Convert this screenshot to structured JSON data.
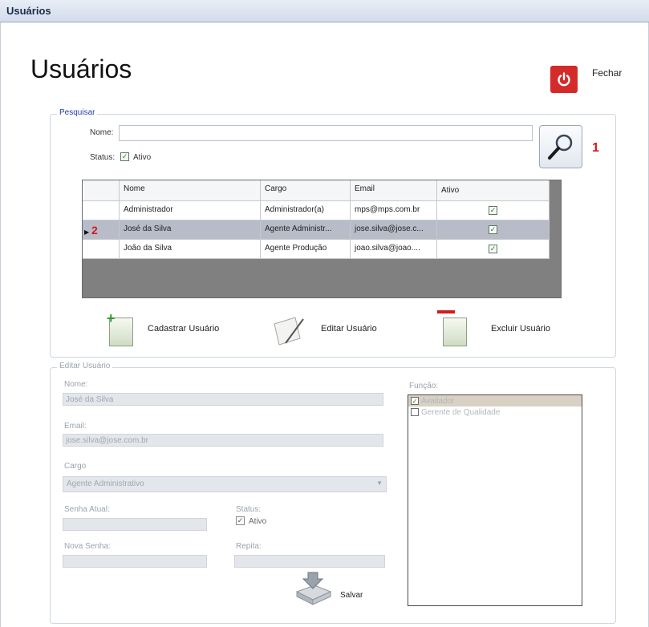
{
  "window": {
    "title": "Usuários"
  },
  "page": {
    "title": "Usuários",
    "close_label": "Fechar"
  },
  "colors": {
    "close_button": "#d42a2a",
    "legend_search": "#1f3fa0",
    "marker": "#d01c1c"
  },
  "search": {
    "legend": "Pesquisar",
    "name_label": "Nome:",
    "name_value": "",
    "status_label": "Status:",
    "active_label": "Ativo",
    "active_checked": true,
    "marker": "1"
  },
  "grid": {
    "columns": [
      "Nome",
      "Cargo",
      "Email",
      "Ativo"
    ],
    "selected_marker": "2",
    "rows": [
      {
        "nome": "Administrador",
        "cargo": "Administrador(a)",
        "email": "mps@mps.com.br",
        "ativo": true
      },
      {
        "nome": "José da Silva",
        "cargo": "Agente Administr...",
        "email": "jose.silva@jose.c...",
        "ativo": true
      },
      {
        "nome": "João da Silva",
        "cargo": "Agente Produção",
        "email": "joao.silva@joao....",
        "ativo": true
      }
    ]
  },
  "actions": {
    "add": "Cadastrar Usuário",
    "edit": "Editar Usuário",
    "delete": "Excluir Usuário"
  },
  "edit": {
    "legend": "Editar Usuário",
    "name_label": "Nome:",
    "name_value": "José da Silva",
    "email_label": "Email:",
    "email_value": "jose.silva@jose.com.br",
    "cargo_label": "Cargo",
    "cargo_value": "Agente Administrativo",
    "current_password_label": "Senha Atual:",
    "status_label": "Status:",
    "active_label": "Ativo",
    "new_password_label": "Nova Senha:",
    "repeat_label": "Repita:",
    "funcao_label": "Função:",
    "funcoes": [
      {
        "label": "Avaliador",
        "checked": true
      },
      {
        "label": "Gerente de Qualidade",
        "checked": false
      }
    ],
    "save_label": "Salvar"
  }
}
